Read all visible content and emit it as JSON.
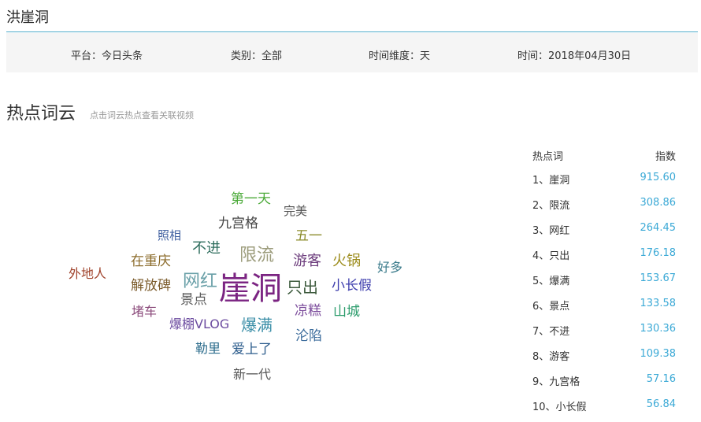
{
  "header": {
    "title": "洪崖洞"
  },
  "filters": [
    {
      "label": "平台：",
      "value": "今日头条"
    },
    {
      "label": "类别：",
      "value": "全部"
    },
    {
      "label": "时间维度：",
      "value": "天"
    },
    {
      "label": "时间：",
      "value": "2018年04月30日"
    }
  ],
  "section": {
    "title": "热点词云",
    "hint": "点击词云热点查看关联视频"
  },
  "cloud_words": [
    {
      "text": "崖洞",
      "color": "#7b2482"
    },
    {
      "text": "限流",
      "color": "#9c9c7c"
    },
    {
      "text": "网红",
      "color": "#6aa0a8"
    },
    {
      "text": "只出",
      "color": "#3c5a3c"
    },
    {
      "text": "爆满",
      "color": "#3c8fa8"
    },
    {
      "text": "第一天",
      "color": "#4caa3a"
    },
    {
      "text": "完美",
      "color": "#555555"
    },
    {
      "text": "九宫格",
      "color": "#444444"
    },
    {
      "text": "五一",
      "color": "#8c8c2c"
    },
    {
      "text": "照相",
      "color": "#4060a0"
    },
    {
      "text": "不进",
      "color": "#2c6c5c"
    },
    {
      "text": "游客",
      "color": "#6c3c7c"
    },
    {
      "text": "火锅",
      "color": "#9c8c1c"
    },
    {
      "text": "好多",
      "color": "#3c7c8c"
    },
    {
      "text": "外地人",
      "color": "#a0432c"
    },
    {
      "text": "在重庆",
      "color": "#8c6c2c"
    },
    {
      "text": "小长假",
      "color": "#3c3cac"
    },
    {
      "text": "解放碑",
      "color": "#7c5c2c"
    },
    {
      "text": "景点",
      "color": "#5c5c5c"
    },
    {
      "text": "凉糕",
      "color": "#7c4c9c"
    },
    {
      "text": "山城",
      "color": "#2c9c6c"
    },
    {
      "text": "堵车",
      "color": "#8c4c7c"
    },
    {
      "text": "爆棚VLOG",
      "color": "#6c4ca0"
    },
    {
      "text": "沦陷",
      "color": "#3c6c9c"
    },
    {
      "text": "勒里",
      "color": "#2c6c8c"
    },
    {
      "text": "爱上了",
      "color": "#2c5c8c"
    },
    {
      "text": "新一代",
      "color": "#555555"
    }
  ],
  "ranking": {
    "header_term": "热点词",
    "header_score": "指数",
    "rows": [
      {
        "term": "1、崖洞",
        "score": "915.60"
      },
      {
        "term": "2、限流",
        "score": "308.86"
      },
      {
        "term": "3、网红",
        "score": "264.45"
      },
      {
        "term": "4、只出",
        "score": "176.18"
      },
      {
        "term": "5、爆满",
        "score": "153.67"
      },
      {
        "term": "6、景点",
        "score": "133.58"
      },
      {
        "term": "7、不进",
        "score": "130.36"
      },
      {
        "term": "8、游客",
        "score": "109.38"
      },
      {
        "term": "9、九宫格",
        "score": "57.16"
      },
      {
        "term": "10、小长假",
        "score": "56.84"
      }
    ]
  }
}
